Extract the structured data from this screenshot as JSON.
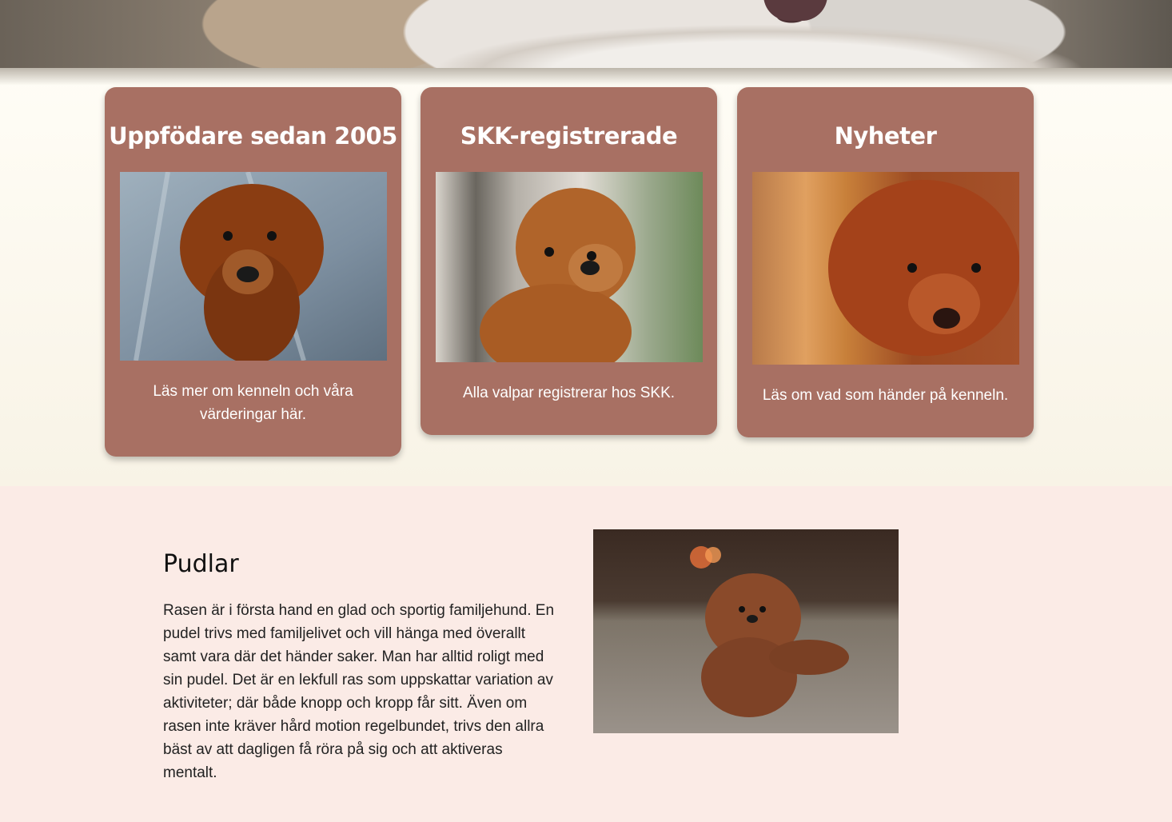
{
  "hero": {
    "alt": "Pudel"
  },
  "cards": [
    {
      "title": "Uppfödare sedan 2005",
      "text": "Läs mer om kenneln och våra värderingar här."
    },
    {
      "title": "SKK-registrerade",
      "text": "Alla valpar registrerar hos SKK."
    },
    {
      "title": "Nyheter",
      "text": "Läs om vad som händer på kenneln."
    }
  ],
  "section": {
    "title": "Pudlar",
    "text": "Rasen är i första hand en glad och sportig familjehund. En pudel trivs med familjelivet och vill hänga med överallt samt vara där det händer saker. Man har alltid roligt med sin pudel. Det är en lekfull ras som uppskattar variation av aktiviteter; där både knopp och kropp får sitt. Även om rasen inte kräver hård motion regelbundet, trivs den allra bäst av att dagligen få röra på sig och att aktiveras mentalt."
  },
  "colors": {
    "card": "#a87063",
    "section_bg": "#fbebe6",
    "page_bg": "#f9f6ec"
  }
}
